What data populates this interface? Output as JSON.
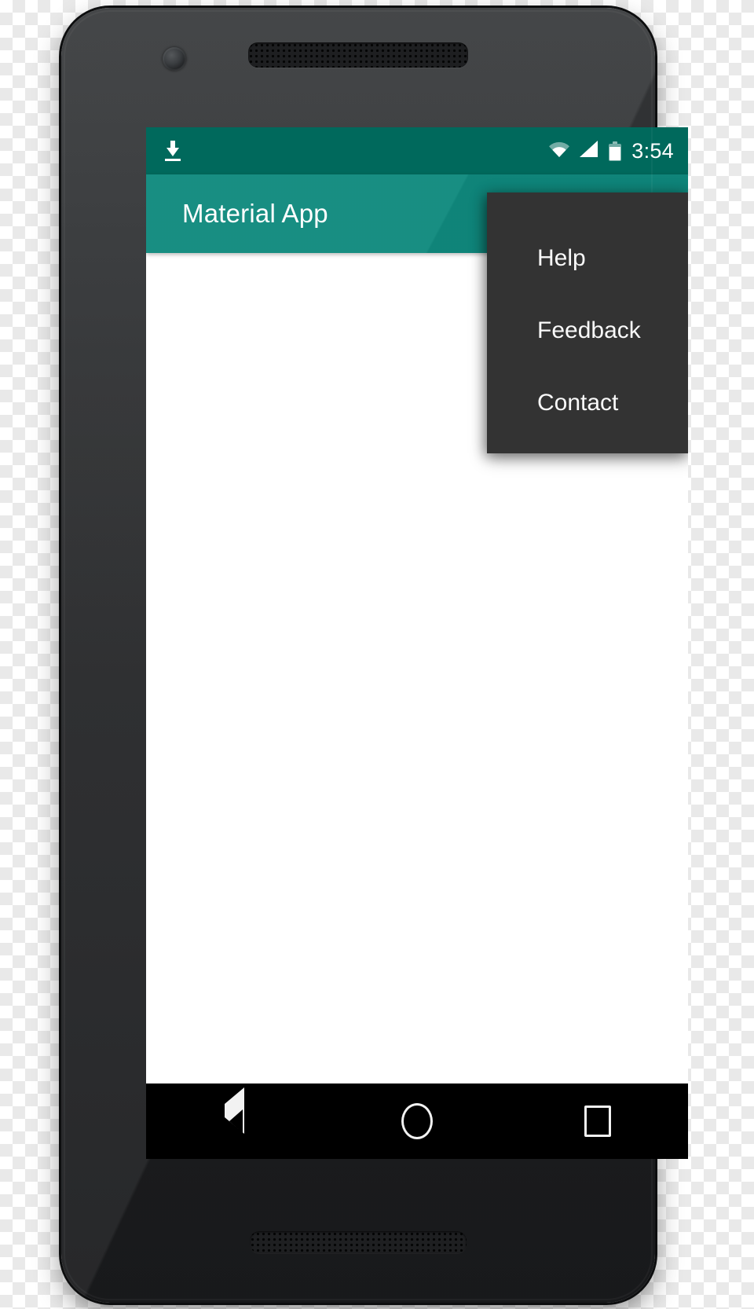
{
  "device": {
    "name": "android-phone-mockup",
    "body_color": "#26282a",
    "hardware": {
      "front_camera": "camera-icon",
      "earpiece_speaker": "speaker-grille",
      "bottom_speaker": "speaker-grille",
      "power_button": "power-button",
      "volume_button": "volume-button"
    }
  },
  "status_bar": {
    "background": "#00695c",
    "left_icons": [
      {
        "name": "download-icon",
        "label": "Download"
      }
    ],
    "right_icons": [
      {
        "name": "wifi-icon",
        "label": "Wi-Fi"
      },
      {
        "name": "signal-icon",
        "label": "Cellular signal"
      },
      {
        "name": "battery-icon",
        "label": "Battery"
      }
    ],
    "clock": "3:54"
  },
  "app_bar": {
    "title": "Material App",
    "background": "#108a7e",
    "text_color": "#ffffff"
  },
  "popup_menu": {
    "background": "#333333",
    "text_color": "#fafafa",
    "items": [
      {
        "label": "Help"
      },
      {
        "label": "Feedback"
      },
      {
        "label": "Contact"
      }
    ]
  },
  "content": {
    "background": "#ffffff",
    "text": ""
  },
  "nav_bar": {
    "background": "#000000",
    "buttons": [
      {
        "name": "back-button",
        "icon": "triangle-left-icon"
      },
      {
        "name": "home-button",
        "icon": "circle-icon"
      },
      {
        "name": "recents-button",
        "icon": "square-icon"
      }
    ]
  }
}
